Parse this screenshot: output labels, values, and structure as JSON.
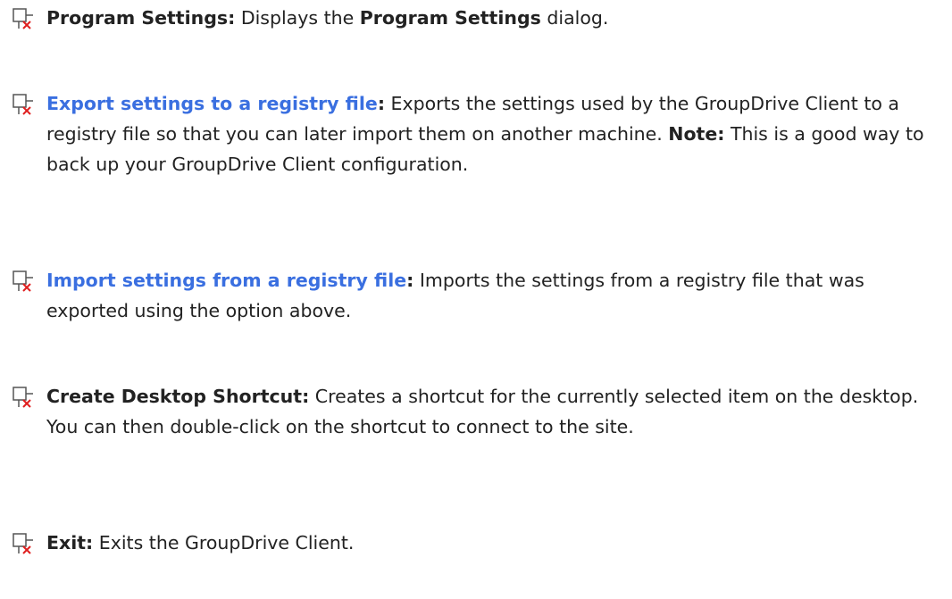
{
  "icon": "broken-image-icon",
  "colors": {
    "link": "#3a6fe0",
    "text": "#222222",
    "icon_x": "#e02020"
  },
  "items": [
    {
      "term": "Program Settings:",
      "text_1": " Displays the ",
      "bold_2": "Program Settings",
      "text_3": " dialog."
    },
    {
      "term": "Export settings to a registry file",
      "colon": ":",
      "text_1": " Exports the settings used by the GroupDrive Client to a registry file so that you can later import them on another machine. ",
      "note_label": "Note:",
      "text_2": " This is a good way to back up your GroupDrive Client configuration."
    },
    {
      "term": "Import settings from a registry file",
      "colon": ":",
      "text_1": " Imports the settings from a registry file that was exported using the option above."
    },
    {
      "term": "Create Desktop Shortcut:",
      "text_1": " Creates a shortcut for the currently selected item on the desktop. You can then double-click on the shortcut to connect to the site."
    },
    {
      "term": "Exit:",
      "text_1": " Exits the GroupDrive Client."
    }
  ]
}
